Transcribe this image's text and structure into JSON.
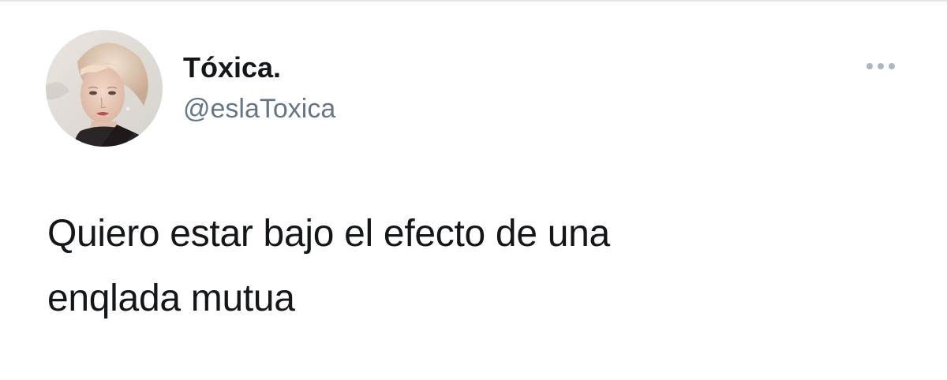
{
  "tweet": {
    "author": {
      "display_name": "Tóxica.",
      "handle": "@eslaToxica",
      "avatar_icon": "portrait-avatar"
    },
    "more_icon": "more-horizontal-icon",
    "text": "Quiero estar bajo el efecto de una\nenqlada mutua"
  },
  "colors": {
    "text_primary": "#14171a",
    "text_secondary": "#657786",
    "icon_muted": "#aab8c2",
    "background": "#ffffff"
  }
}
